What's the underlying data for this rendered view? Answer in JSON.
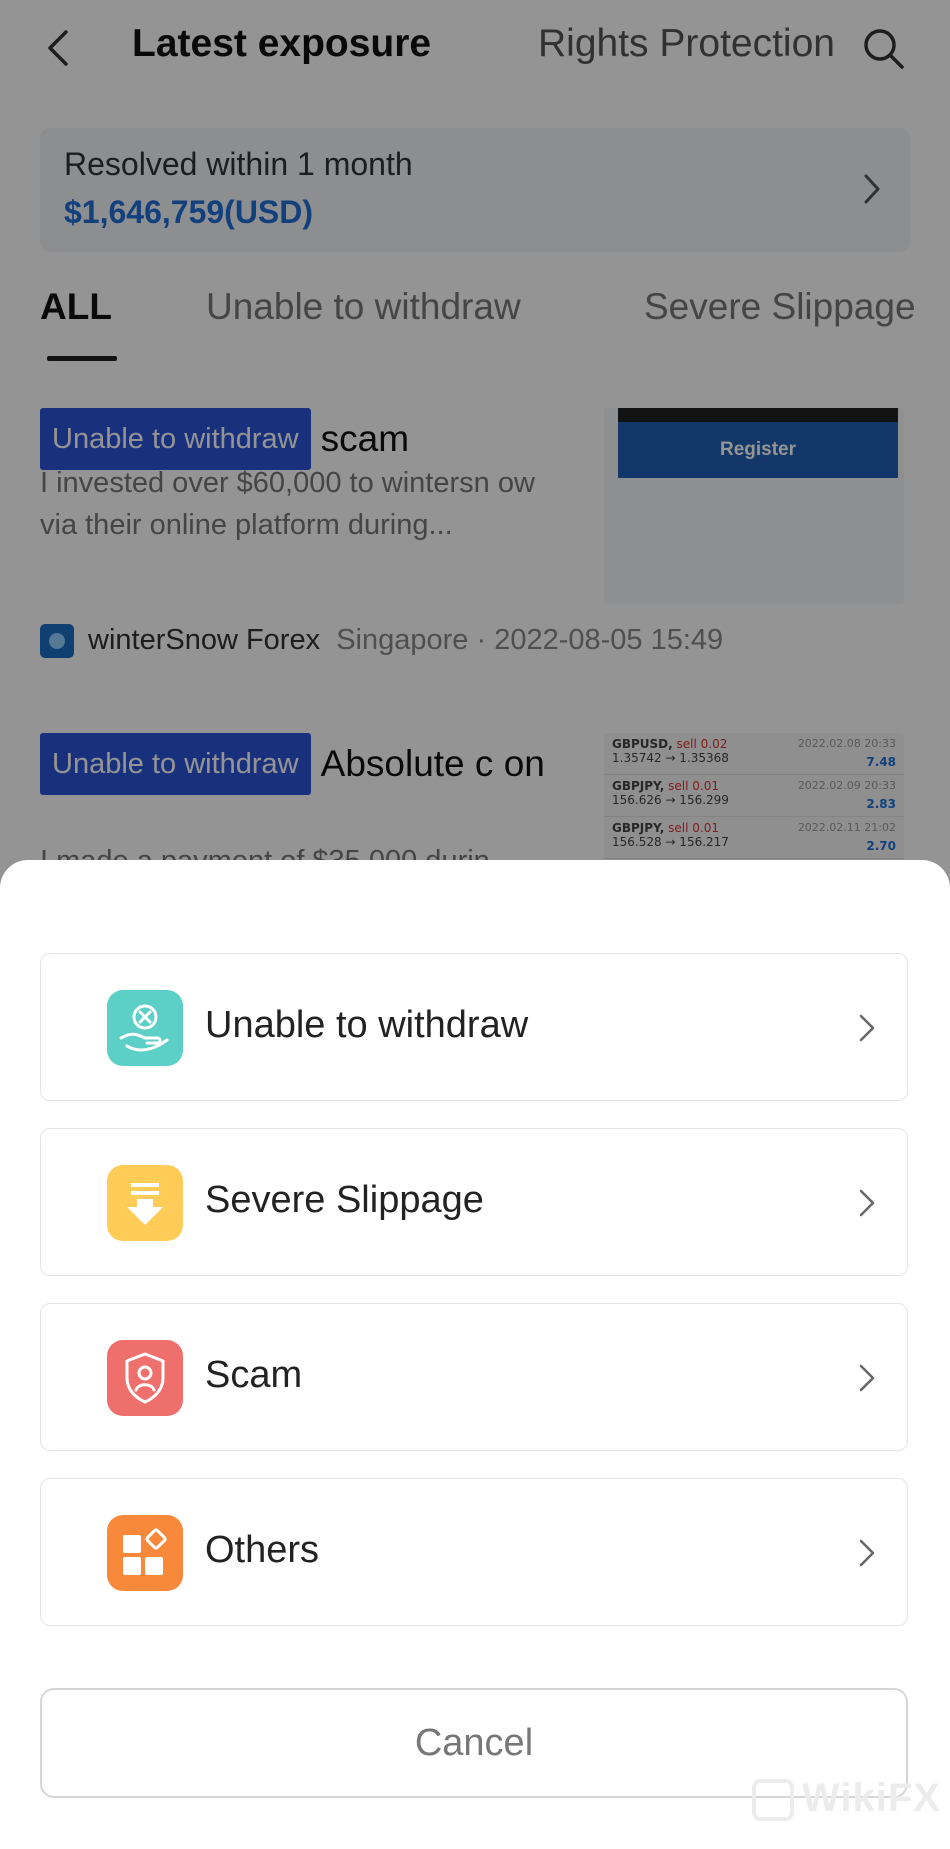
{
  "header": {
    "title": "Latest exposure",
    "rights_link": "Rights Protection"
  },
  "resolved": {
    "label": "Resolved within 1 month",
    "amount": "$1,646,759(USD)"
  },
  "tabs": [
    {
      "label": "ALL",
      "active": true
    },
    {
      "label": "Unable to withdraw",
      "active": false
    },
    {
      "label": "Severe Slippage",
      "active": false
    }
  ],
  "feed": [
    {
      "tag": "Unable to withdraw",
      "title": "scam",
      "excerpt": "I invested over $60,000 to wintersn ow via their online platform during...",
      "thumb_button": "Register",
      "broker": "winterSnow Forex",
      "location_time": "Singapore · 2022-08-05 15:49"
    },
    {
      "tag": "Unable to withdraw",
      "title": "Absolute c on",
      "excerpt": "I made a payment of $35,000 durin",
      "trades": [
        {
          "pair": "GBPUSD,",
          "side": "sell 0.02",
          "prices": "1.35742 → 1.35368",
          "date": "2022.02.08 20:33",
          "pnl": "7.48"
        },
        {
          "pair": "GBPJPY,",
          "side": "sell 0.01",
          "prices": "156.626 → 156.299",
          "date": "2022.02.09 20:33",
          "pnl": "2.83"
        },
        {
          "pair": "GBPJPY,",
          "side": "sell 0.01",
          "prices": "156.528 → 156.217",
          "date": "2022.02.11 21:02",
          "pnl": "2.70"
        }
      ]
    }
  ],
  "sheet": {
    "options": [
      {
        "label": "Unable to withdraw",
        "icon": "hand-x-icon",
        "color": "#5ccfc6"
      },
      {
        "label": "Severe Slippage",
        "icon": "arrow-down-icon",
        "color": "#ffcc57"
      },
      {
        "label": "Scam",
        "icon": "shield-person-icon",
        "color": "#ee6f6b"
      },
      {
        "label": "Others",
        "icon": "grid-icon",
        "color": "#f8893b"
      }
    ],
    "cancel_label": "Cancel"
  },
  "watermark": "WikiFX"
}
